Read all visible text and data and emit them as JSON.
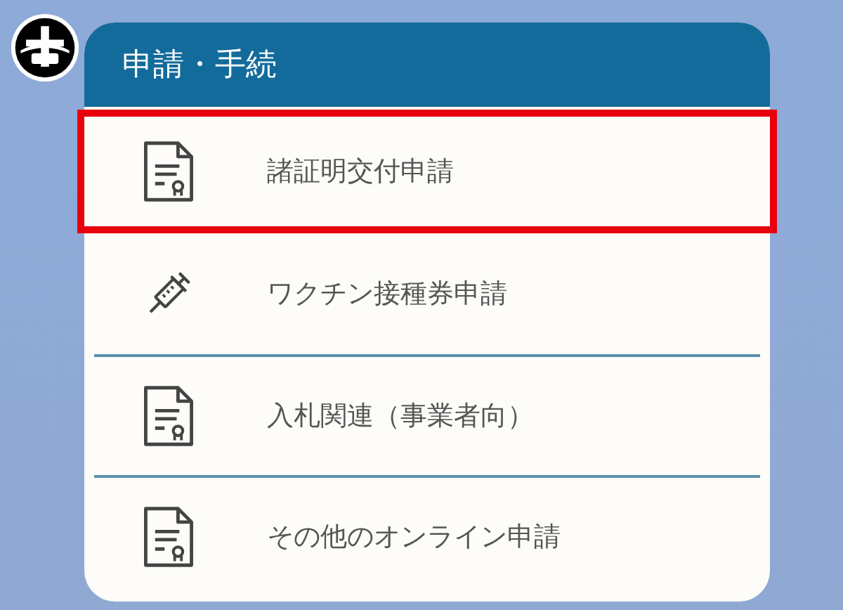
{
  "panel": {
    "title": "申請・手続"
  },
  "items": [
    {
      "label": "諸証明交付申請",
      "kind": "document",
      "highlighted": true
    },
    {
      "label": "ワクチン接種券申請",
      "kind": "syringe",
      "highlighted": false
    },
    {
      "label": "入札関連（事業者向）",
      "kind": "document",
      "highlighted": false
    },
    {
      "label": "その他のオンライン申請",
      "kind": "document",
      "highlighted": false
    }
  ]
}
